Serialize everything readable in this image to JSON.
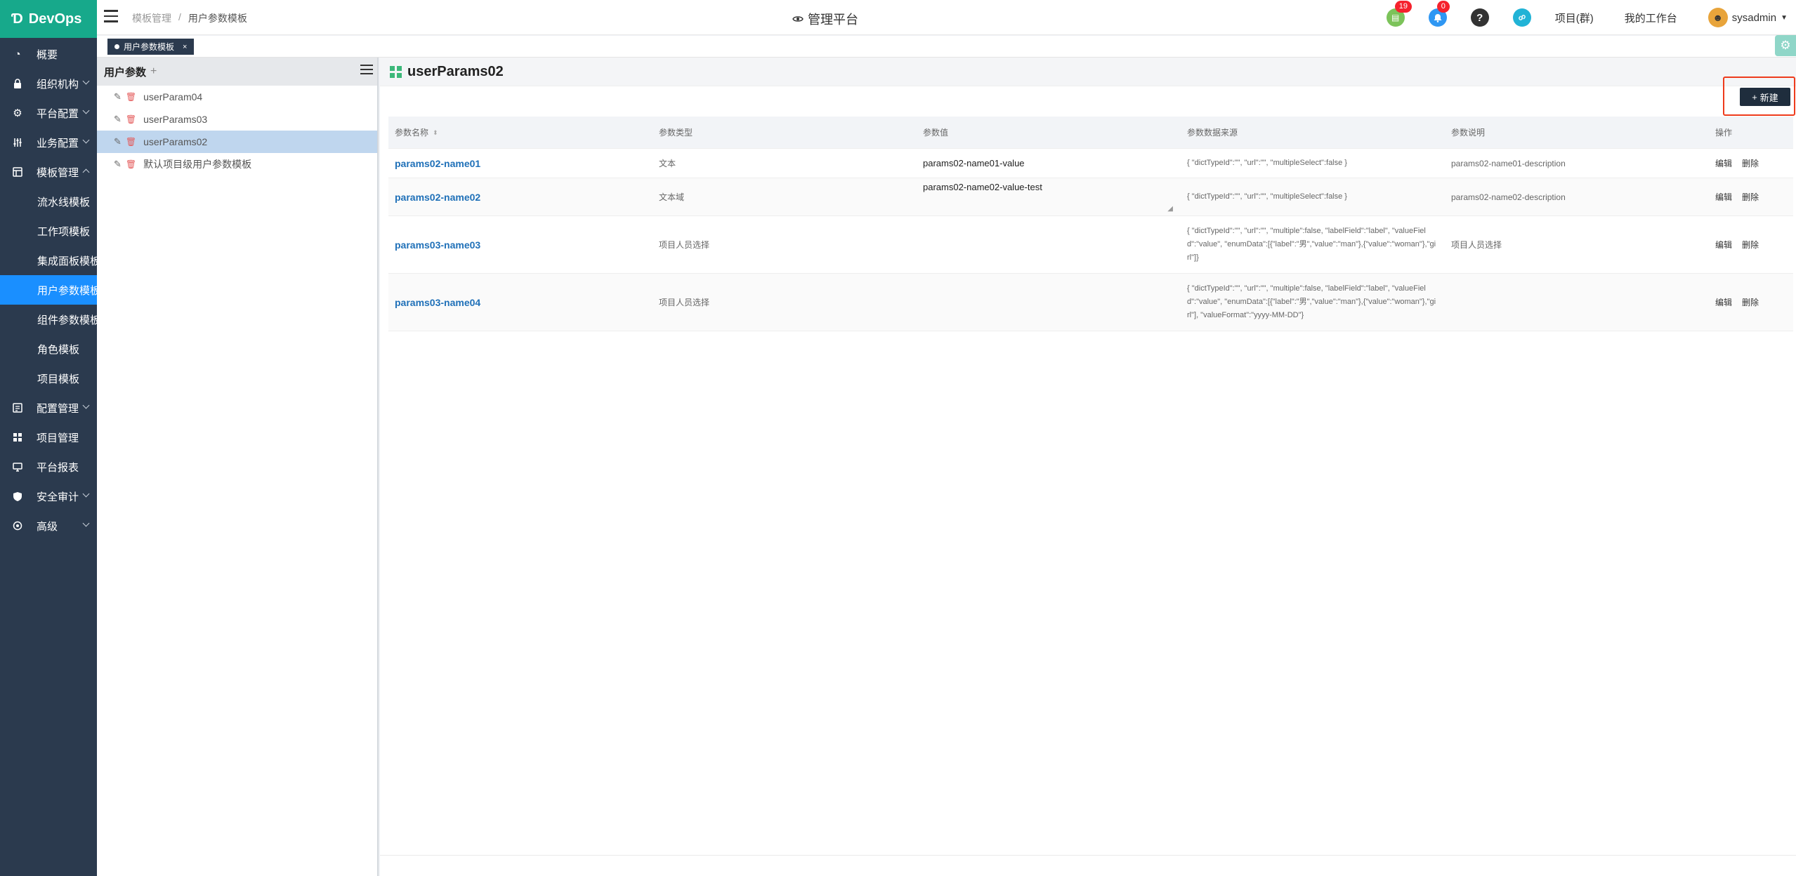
{
  "app": {
    "logo_icon": "Ɗ",
    "logo_text": "DevOps"
  },
  "sidebar": {
    "items": [
      {
        "label": "概要",
        "icon": "dashboard-icon",
        "glyph": "◔",
        "chevron": false
      },
      {
        "label": "组织机构",
        "icon": "lock-icon",
        "glyph": "🔒",
        "chevron": true
      },
      {
        "label": "平台配置",
        "icon": "gear-icon",
        "glyph": "⚙",
        "chevron": true
      },
      {
        "label": "业务配置",
        "icon": "sliders-icon",
        "glyph": "⫶",
        "chevron": true
      },
      {
        "label": "模板管理",
        "icon": "template-icon",
        "glyph": "▤",
        "chevron": true,
        "expanded": true
      }
    ],
    "sub_items": [
      {
        "label": "流水线模板"
      },
      {
        "label": "工作项模板"
      },
      {
        "label": "集成面板模板"
      },
      {
        "label": "用户参数模板",
        "active": true
      },
      {
        "label": "组件参数模板"
      },
      {
        "label": "角色模板"
      },
      {
        "label": "项目模板"
      }
    ],
    "items_after": [
      {
        "label": "配置管理",
        "icon": "config-icon",
        "glyph": "▦",
        "chevron": true
      },
      {
        "label": "项目管理",
        "icon": "grid-icon",
        "glyph": "▦",
        "chevron": false
      },
      {
        "label": "平台报表",
        "icon": "monitor-icon",
        "glyph": "▭",
        "chevron": false
      },
      {
        "label": "安全审计",
        "icon": "shield-icon",
        "glyph": "⛨",
        "chevron": true
      },
      {
        "label": "高级",
        "icon": "advanced-icon",
        "glyph": "◎",
        "chevron": true
      }
    ]
  },
  "header": {
    "breadcrumb": [
      "模板管理",
      "/",
      "用户参数模板"
    ],
    "title": "管理平台",
    "todo_badge": "19",
    "bell_badge": "0",
    "help_glyph": "?",
    "link_glyph": "⚭",
    "todo_glyph": "▤",
    "bell_glyph": "🔔",
    "projects_link": "项目(群)",
    "workbench_link": "我的工作台",
    "username": "sysadmin",
    "colors": {
      "todo": "#7cc35a",
      "bell": "#2f97f3",
      "help": "#333333",
      "link": "#21b3d6"
    }
  },
  "tabs": [
    {
      "label": "用户参数模板",
      "close": "×"
    }
  ],
  "left_panel": {
    "title": "用户参数",
    "add": "+",
    "items": [
      {
        "label": "userParam04"
      },
      {
        "label": "userParams03"
      },
      {
        "label": "userParams02",
        "active": true
      },
      {
        "label": "默认项目级用户参数模板"
      }
    ],
    "edit_glyph": "✎",
    "del_glyph": "🗑"
  },
  "main": {
    "title": "userParams02",
    "new_button": "新建",
    "new_icon": "+",
    "columns": [
      "参数名称",
      "参数类型",
      "参数值",
      "参数数据来源",
      "参数说明",
      "操作"
    ],
    "sort_glyph": "⬍",
    "rows": [
      {
        "name": "params02-name01",
        "type": "文本",
        "value": "params02-name01-value",
        "source": "{ \"dictTypeId\":\"\", \"url\":\"\", \"multipleSelect\":false }",
        "desc": "params02-name01-description",
        "edit": "编辑",
        "del": "删除"
      },
      {
        "name": "params02-name02",
        "type": "文本域",
        "value": "params02-name02-value-test",
        "source": "{ \"dictTypeId\":\"\", \"url\":\"\", \"multipleSelect\":false }",
        "desc": "params02-name02-description",
        "edit": "编辑",
        "del": "删除"
      },
      {
        "name": "params03-name03",
        "type": "项目人员选择",
        "value": "",
        "source": "{ \"dictTypeId\":\"\", \"url\":\"\", \"multiple\":false, \"labelField\":\"label\", \"valueField\":\"value\", \"enumData\":[{\"label\":\"男\",\"value\":\"man\"},{\"value\":\"woman\"},\"girl\"]}",
        "desc": "项目人员选择",
        "edit": "编辑",
        "del": "删除"
      },
      {
        "name": "params03-name04",
        "type": "项目人员选择",
        "value": "",
        "source": "{ \"dictTypeId\":\"\", \"url\":\"\", \"multiple\":false, \"labelField\":\"label\", \"valueField\":\"value\", \"enumData\":[{\"label\":\"男\",\"value\":\"man\"},{\"value\":\"woman\"},\"girl\"], \"valueFormat\":\"yyyy-MM-DD\"}",
        "desc": "",
        "edit": "编辑",
        "del": "删除"
      }
    ]
  }
}
